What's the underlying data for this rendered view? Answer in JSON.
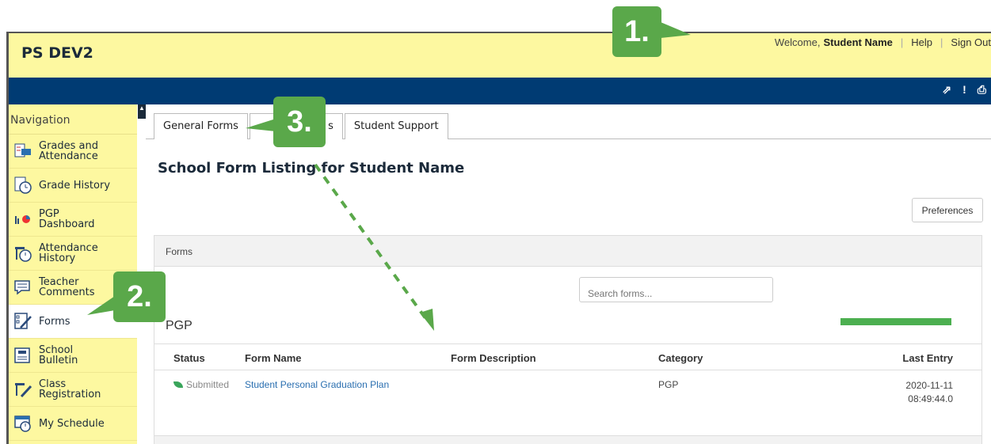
{
  "header": {
    "brand": "PS DEV2",
    "welcome_prefix": "Welcome,",
    "user_name": "Student Name",
    "help": "Help",
    "sign_out": "Sign Out"
  },
  "toolbar": {
    "icons": [
      "external-link-icon",
      "alert-icon",
      "print-icon"
    ],
    "external": "⇗",
    "alert": "!",
    "print": "⎙"
  },
  "sidebar": {
    "title": "Navigation",
    "items": [
      {
        "label": "Grades and Attendance",
        "icon": "grades-attendance-icon"
      },
      {
        "label": "Grade History",
        "icon": "grade-history-icon"
      },
      {
        "label": "PGP Dashboard",
        "icon": "pgp-dashboard-icon"
      },
      {
        "label": "Attendance History",
        "icon": "attendance-history-icon"
      },
      {
        "label": "Teacher Comments",
        "icon": "teacher-comments-icon"
      },
      {
        "label": "Forms",
        "icon": "forms-icon"
      },
      {
        "label": "School Bulletin",
        "icon": "school-bulletin-icon"
      },
      {
        "label": "Class Registration",
        "icon": "class-registration-icon"
      },
      {
        "label": "My Schedule",
        "icon": "my-schedule-icon"
      }
    ]
  },
  "tabs": [
    {
      "label": "General Forms"
    },
    {
      "label": "s"
    },
    {
      "label": "Student Support"
    }
  ],
  "main": {
    "title": "School Form Listing for Student Name",
    "preferences": "Preferences",
    "panel_title": "Forms",
    "search_placeholder": "Search forms...",
    "section": "PGP"
  },
  "table": {
    "headers": [
      "Status",
      "Form Name",
      "Form Description",
      "Category",
      "Last Entry"
    ],
    "rows": [
      {
        "status": "Submitted",
        "form_name": "Student Personal Graduation Plan",
        "description": "",
        "category": "PGP",
        "last_entry_date": "2020-11-11",
        "last_entry_time": "08:49:44.0"
      }
    ]
  },
  "annotations": {
    "badge1": "1.",
    "badge2": "2.",
    "badge3": "3.",
    "color": "#5aa84a"
  }
}
